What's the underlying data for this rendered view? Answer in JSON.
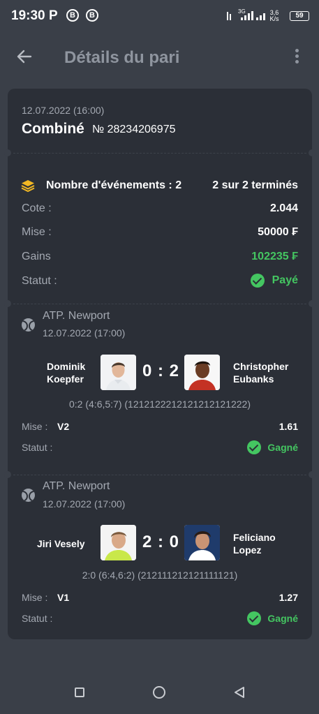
{
  "status_bar": {
    "time": "19:30",
    "p_glyph": "P",
    "b_glyph_1": "B",
    "b_glyph_2": "B",
    "network_rate_value": "3,6",
    "network_rate_unit": "K/s",
    "network_type": "3G",
    "battery": "59"
  },
  "app_bar": {
    "title": "Détails du pari"
  },
  "bet": {
    "date": "12.07.2022 (16:00)",
    "type": "Combiné",
    "number_label": "№ 28234206975",
    "events_label": "Nombre d'événements : 2",
    "events_finished": "2 sur 2 terminés",
    "odds_label": "Cote :",
    "odds_value": "2.044",
    "stake_label": "Mise :",
    "stake_value": "50000 ₣",
    "winnings_label": "Gains",
    "winnings_value": "102235 ₣",
    "status_label": "Statut :",
    "status_value": "Payé"
  },
  "events": [
    {
      "tournament": "ATP. Newport",
      "date": "12.07.2022 (17:00)",
      "player1_line1": "Dominik",
      "player1_line2": "Koepfer",
      "player2_line1": "Christopher",
      "player2_line2": "Eubanks",
      "score": "0 : 2",
      "details": "0:2 (4:6,5:7) (1212122212121212121222)",
      "bet_label": "Mise :",
      "bet_pick": "V2",
      "odds": "1.61",
      "status_label": "Statut :",
      "status_value": "Gagné"
    },
    {
      "tournament": "ATP. Newport",
      "date": "12.07.2022 (17:00)",
      "player1_line1": "Jiri Vesely",
      "player1_line2": "",
      "player2_line1": "Feliciano",
      "player2_line2": "Lopez",
      "score": "2 : 0",
      "details": "2:0 (6:4,6:2) (212111212121111121)",
      "bet_label": "Mise :",
      "bet_pick": "V1",
      "odds": "1.27",
      "status_label": "Statut :",
      "status_value": "Gagné"
    }
  ],
  "colors": {
    "background": "#3a3f48",
    "card": "#2b2f37",
    "accent_green": "#44c661",
    "accent_yellow": "#f2b824",
    "muted_text": "#a4a9b2"
  },
  "icons": [
    "back-arrow-icon",
    "more-vertical-icon",
    "layers-icon",
    "check-circle-icon",
    "tennis-ball-icon",
    "nav-recents-icon",
    "nav-home-icon",
    "nav-back-icon"
  ]
}
